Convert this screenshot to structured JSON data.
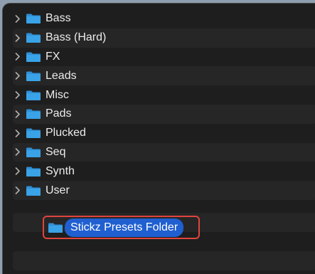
{
  "folders": [
    {
      "label": "Bass"
    },
    {
      "label": "Bass (Hard)"
    },
    {
      "label": "FX"
    },
    {
      "label": "Leads"
    },
    {
      "label": "Misc"
    },
    {
      "label": "Pads"
    },
    {
      "label": "Plucked"
    },
    {
      "label": "Seq"
    },
    {
      "label": "Synth"
    },
    {
      "label": "User"
    }
  ],
  "dragged_item": {
    "label": "Stickz Presets Folder",
    "icon": "folder-icon"
  },
  "colors": {
    "background": "#1e1e1e",
    "folder": "#3aa2e6",
    "selection": "#1f5fd0",
    "highlight_outline": "#e0443e"
  }
}
